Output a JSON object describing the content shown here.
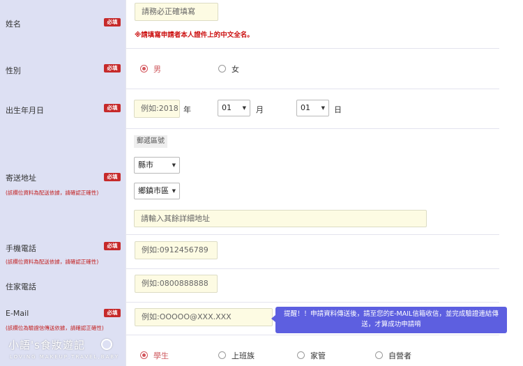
{
  "required_badge": "必填",
  "name": {
    "label": "姓名",
    "placeholder": "請務必正確填寫",
    "warning": "※請填寫申請者本人證件上的中文全名。"
  },
  "gender": {
    "label": "性別",
    "options": [
      {
        "label": "男",
        "selected": true
      },
      {
        "label": "女",
        "selected": false
      }
    ]
  },
  "birthday": {
    "label": "出生年月日",
    "year_placeholder": "例如:2018",
    "year_unit": "年",
    "month_value": "01",
    "month_unit": "月",
    "day_value": "01",
    "day_unit": "日"
  },
  "address": {
    "label": "寄送地址",
    "note": "(該欄位資料為配送依據，請確認正確性)",
    "postal_label": "郵遞區號",
    "county_select": "縣市",
    "district_select": "鄉鎮市區",
    "detail_placeholder": "請輸入其餘詳細地址"
  },
  "mobile": {
    "label": "手機電話",
    "note": "(該欄位資料為配送依據，請確認正確性)",
    "placeholder": "例如:0912456789"
  },
  "home_phone": {
    "label": "住家電話",
    "placeholder": "例如:0800888888"
  },
  "email": {
    "label": "E-Mail",
    "note": "(該欄位為驗證信傳送依據，請確認正確性)",
    "placeholder": "例如:OOOOO@XXX.XXX",
    "tooltip": "提醒！！申請資料傳送後，請至您的E-MAIL信箱收信，並完成驗證連結傳送，才算成功申請唷"
  },
  "occupation": {
    "options": [
      {
        "label": "學生",
        "selected": true
      },
      {
        "label": "上班族",
        "selected": false
      },
      {
        "label": "家管",
        "selected": false
      },
      {
        "label": "自營者",
        "selected": false
      }
    ]
  },
  "watermark": {
    "title": "小語's食妝遊記",
    "subtitle": "LOVING MAKEUP,TRAVEL,BABY"
  },
  "colors": {
    "label_bg": "#dde0f3",
    "required_badge": "#c62a2a",
    "input_bg": "#fdfbe3",
    "radio_selected": "#d2555c",
    "tooltip_bg": "#5d5fe0"
  }
}
